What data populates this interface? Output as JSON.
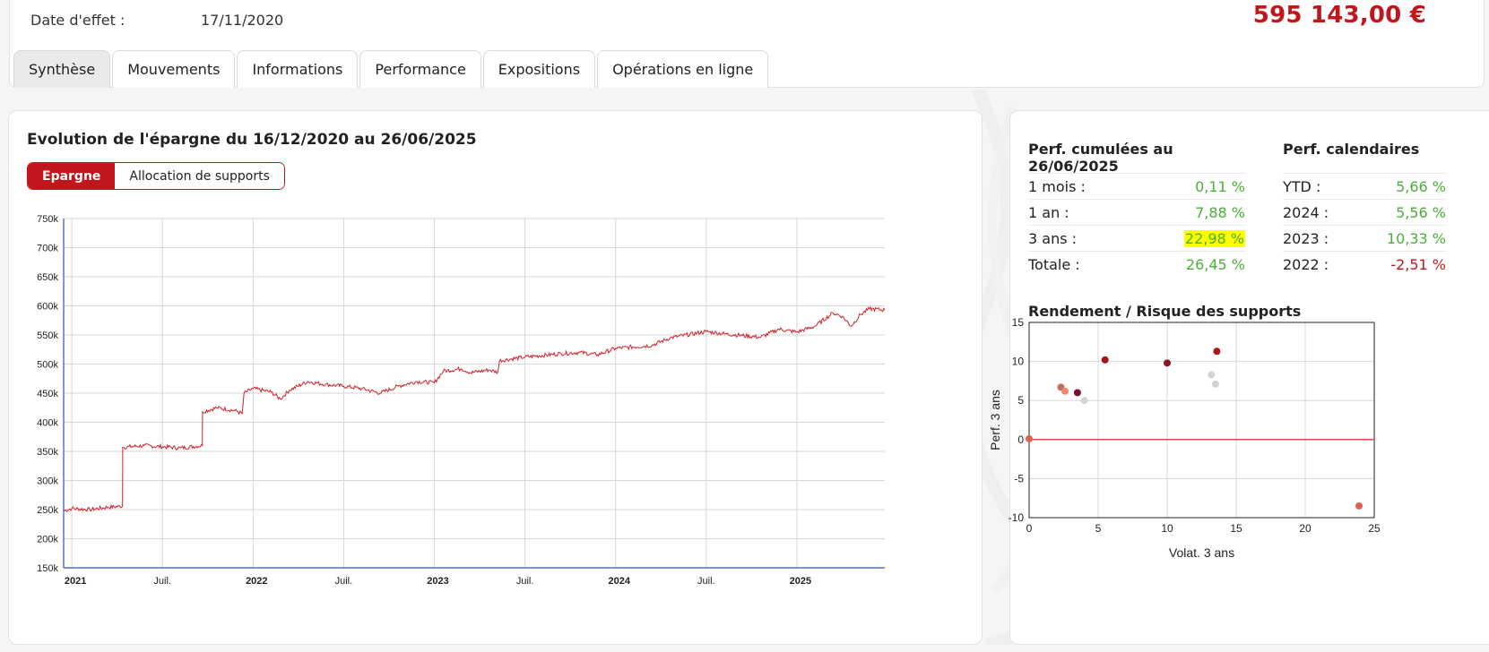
{
  "header": {
    "date_label": "Date d'effet :",
    "date_value": "17/11/2020",
    "total_amount": "595 143,00 €"
  },
  "tabs": [
    {
      "label": "Synthèse",
      "active": true
    },
    {
      "label": "Mouvements",
      "active": false
    },
    {
      "label": "Informations",
      "active": false
    },
    {
      "label": "Performance",
      "active": false
    },
    {
      "label": "Expositions",
      "active": false
    },
    {
      "label": "Opérations en ligne",
      "active": false
    }
  ],
  "evolution": {
    "title": "Evolution de l'épargne du 16/12/2020 au 26/06/2025",
    "toggle": {
      "epargne": "Epargne",
      "allocation": "Allocation de supports"
    }
  },
  "perf_cumulees": {
    "title": "Perf. cumulées au 26/06/2025",
    "rows": [
      {
        "label": "1 mois :",
        "value": "0,11 %"
      },
      {
        "label": "1 an :",
        "value": "7,88 %"
      },
      {
        "label": "3 ans :",
        "value": "22,98 %"
      },
      {
        "label": "Totale :",
        "value": "26,45 %"
      }
    ]
  },
  "perf_calendaires": {
    "title": "Perf. calendaires",
    "rows": [
      {
        "label": "YTD :",
        "value": "5,66 %"
      },
      {
        "label": "2024 :",
        "value": "5,56 %"
      },
      {
        "label": "2023 :",
        "value": "10,33 %"
      },
      {
        "label": "2022 :",
        "value": "-2,51 %"
      }
    ]
  },
  "risk": {
    "title": "Rendement / Risque des supports"
  },
  "colors": {
    "accent": "#c2161d",
    "positive": "#4cae3a",
    "axis_blue": "#2a52be"
  },
  "chart_data": [
    {
      "type": "line",
      "ylim": [
        150000,
        750000
      ],
      "y_ticks": [
        150000,
        200000,
        250000,
        300000,
        350000,
        400000,
        450000,
        500000,
        550000,
        600000,
        650000,
        700000,
        750000
      ],
      "y_tick_labels": [
        "150k",
        "200k",
        "250k",
        "300k",
        "350k",
        "400k",
        "450k",
        "500k",
        "550k",
        "600k",
        "650k",
        "700k",
        "750k"
      ],
      "x_ticks": [
        {
          "label": "2021",
          "t": 2021.0,
          "bold": true
        },
        {
          "label": "Juil.",
          "t": 2021.5,
          "bold": false
        },
        {
          "label": "2022",
          "t": 2022.0,
          "bold": true
        },
        {
          "label": "Juil.",
          "t": 2022.5,
          "bold": false
        },
        {
          "label": "2023",
          "t": 2023.0,
          "bold": true
        },
        {
          "label": "Juil.",
          "t": 2023.5,
          "bold": false
        },
        {
          "label": "2024",
          "t": 2024.0,
          "bold": true
        },
        {
          "label": "Juil.",
          "t": 2024.5,
          "bold": false
        },
        {
          "label": "2025",
          "t": 2025.0,
          "bold": true
        }
      ],
      "x": [
        2020.955,
        2021.0,
        2021.1,
        2021.2,
        2021.28,
        2021.281,
        2021.4,
        2021.5,
        2021.6,
        2021.72,
        2021.721,
        2021.8,
        2021.9,
        2021.94,
        2021.95,
        2022.0,
        2022.1,
        2022.15,
        2022.2,
        2022.3,
        2022.4,
        2022.5,
        2022.6,
        2022.7,
        2022.8,
        2022.9,
        2023.0,
        2023.05,
        2023.15,
        2023.2,
        2023.3,
        2023.35,
        2023.36,
        2023.5,
        2023.7,
        2023.8,
        2023.9,
        2024.0,
        2024.2,
        2024.3,
        2024.5,
        2024.6,
        2024.7,
        2024.8,
        2024.9,
        2025.0,
        2025.1,
        2025.2,
        2025.25,
        2025.3,
        2025.35,
        2025.4,
        2025.485
      ],
      "values": [
        248000,
        252000,
        250000,
        254000,
        256000,
        357000,
        360000,
        358000,
        356000,
        360000,
        418000,
        425000,
        420000,
        415000,
        450000,
        458000,
        452000,
        440000,
        455000,
        470000,
        465000,
        462000,
        458000,
        450000,
        462000,
        470000,
        468000,
        488000,
        492000,
        485000,
        490000,
        486000,
        506000,
        512000,
        518000,
        520000,
        516000,
        527000,
        532000,
        545000,
        556000,
        552000,
        549000,
        546000,
        560000,
        555000,
        565000,
        588000,
        582000,
        565000,
        585000,
        595000,
        593000
      ]
    },
    {
      "type": "scatter",
      "xlabel": "Volat. 3 ans",
      "ylabel": "Perf. 3 ans",
      "xlim": [
        0,
        25
      ],
      "ylim": [
        -10,
        15
      ],
      "x_ticks": [
        0,
        5,
        10,
        15,
        20,
        25
      ],
      "y_ticks": [
        -10,
        -5,
        0,
        5,
        10,
        15
      ],
      "points": [
        {
          "x": 0.0,
          "y": 0.1,
          "color": "#e0634f"
        },
        {
          "x": 2.3,
          "y": 6.7,
          "color": "#c56a67"
        },
        {
          "x": 2.6,
          "y": 6.2,
          "color": "#f08a6a"
        },
        {
          "x": 3.5,
          "y": 6.0,
          "color": "#7a1030"
        },
        {
          "x": 4.0,
          "y": 5.0,
          "color": "#d3d3d3"
        },
        {
          "x": 5.5,
          "y": 10.2,
          "color": "#a3141c"
        },
        {
          "x": 10.0,
          "y": 9.8,
          "color": "#8a1528"
        },
        {
          "x": 13.2,
          "y": 8.3,
          "color": "#d3d3d3"
        },
        {
          "x": 13.5,
          "y": 7.1,
          "color": "#d3d3d3"
        },
        {
          "x": 13.6,
          "y": 11.3,
          "color": "#b5121b"
        },
        {
          "x": 23.9,
          "y": -8.5,
          "color": "#e0634f"
        }
      ]
    }
  ]
}
